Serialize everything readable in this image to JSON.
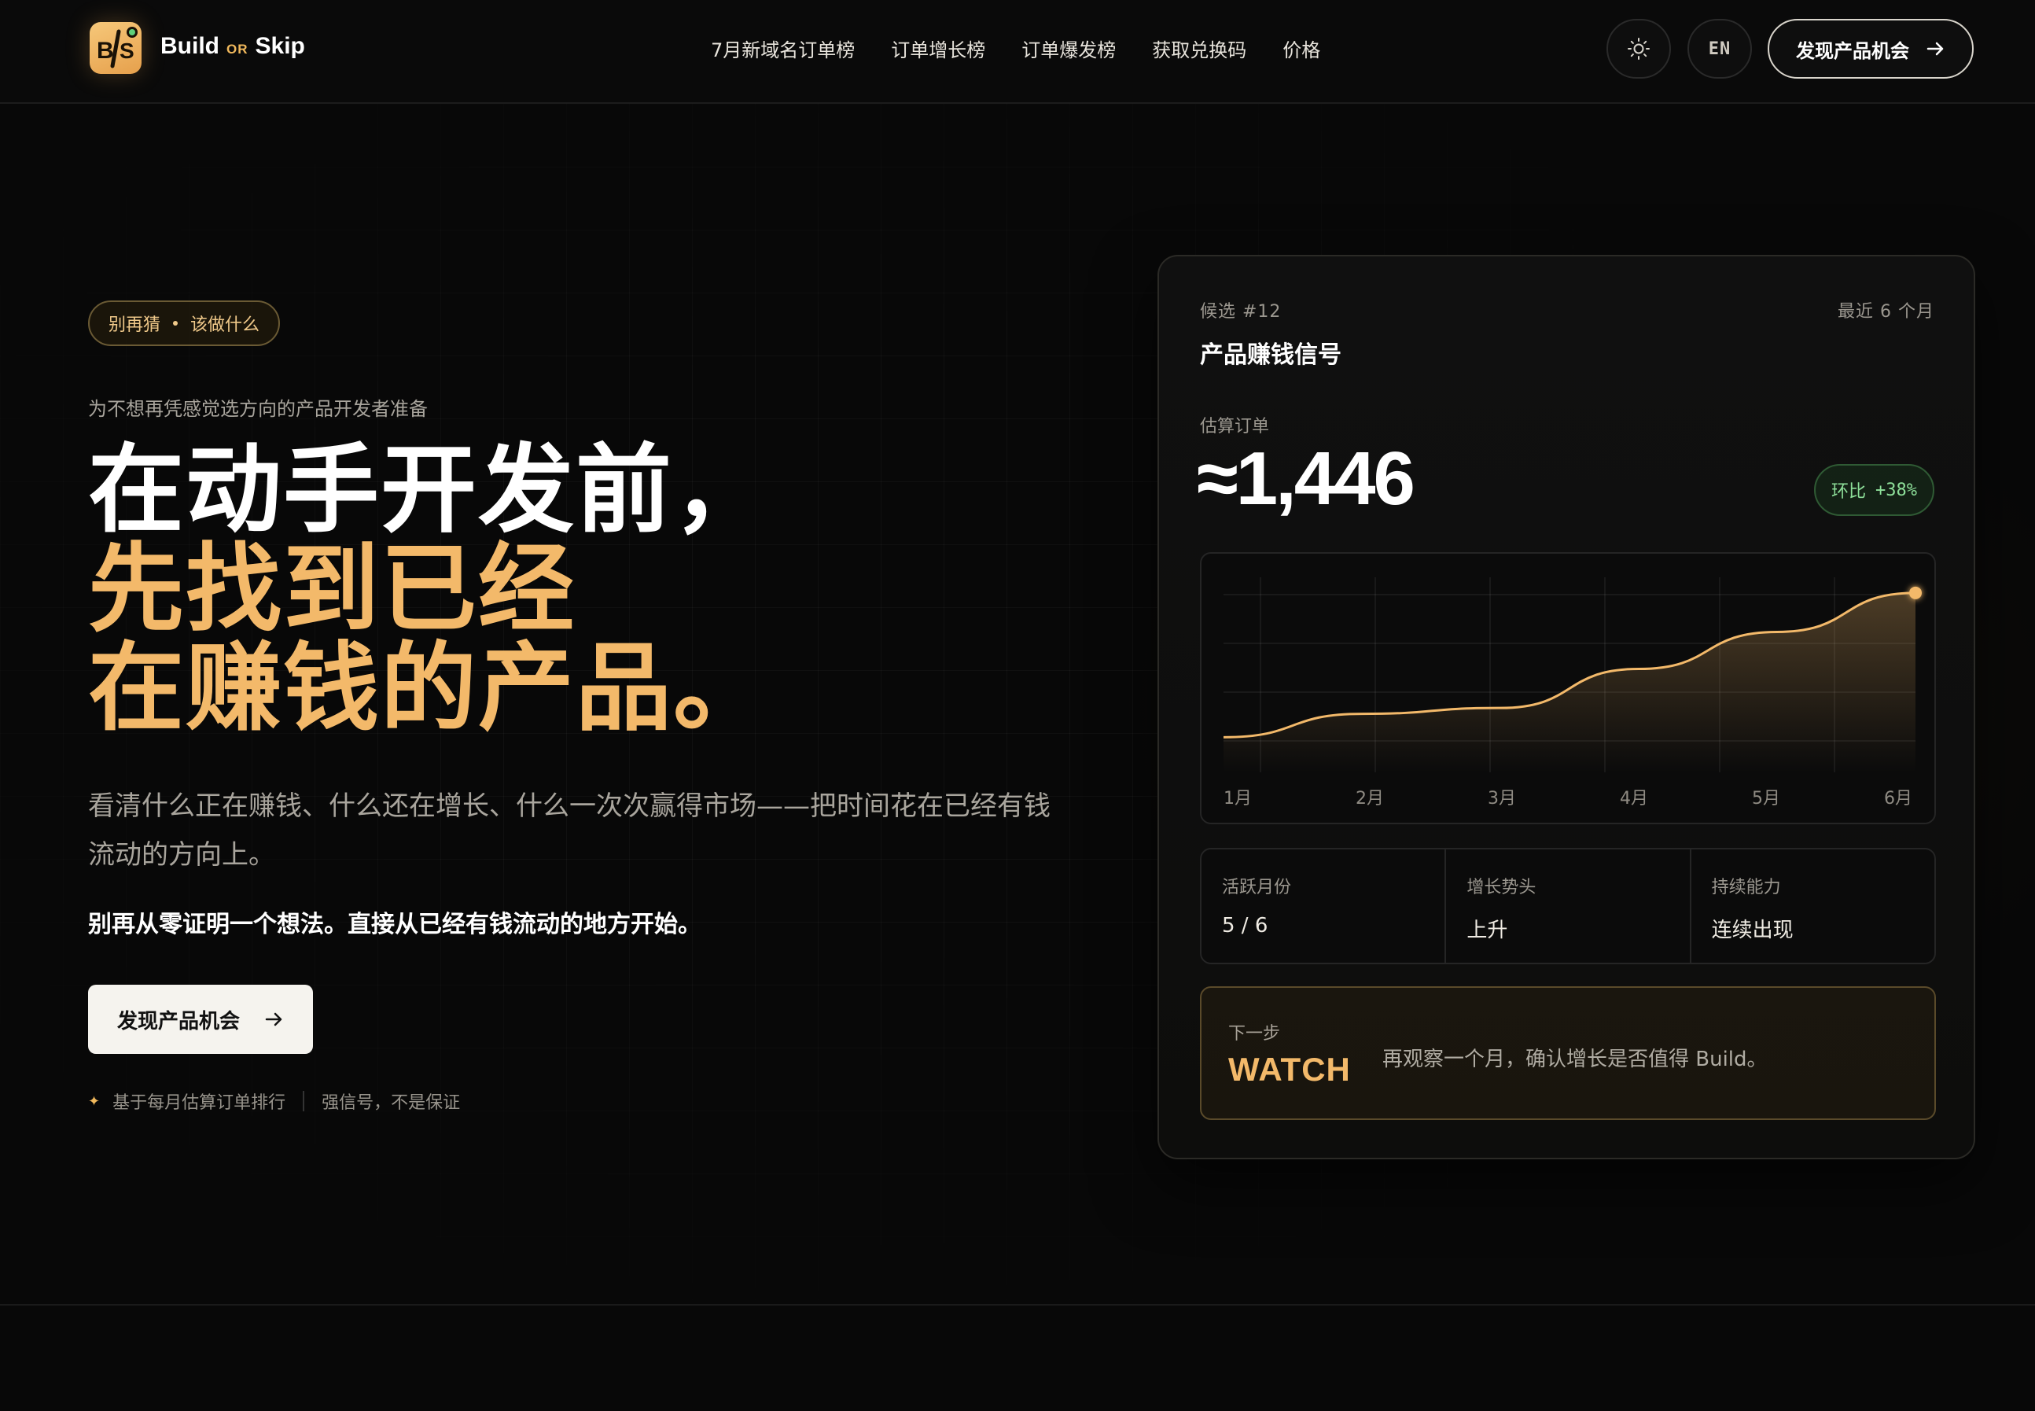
{
  "brand": {
    "name_left": "Build",
    "name_or": "OR",
    "name_right": "Skip",
    "logo_text": "B/S",
    "accent": "#F3B96A"
  },
  "nav": {
    "items": [
      "7月新域名订单榜",
      "订单增长榜",
      "订单爆发榜",
      "获取兑换码",
      "价格"
    ]
  },
  "header": {
    "theme_icon": "sun-icon",
    "lang_label": "EN",
    "cta_label": "发现产品机会",
    "cta_icon": "arrow-right-icon"
  },
  "hero": {
    "pill_left": "别再猜",
    "pill_right": "该做什么",
    "subtitle": "为不想再凭感觉选方向的产品开发者准备",
    "headline_1": "在动手开发前，",
    "headline_2": "先找到已经",
    "headline_3": "在赚钱的产品。",
    "description": "看清什么正在赚钱、什么还在增长、什么一次次赢得市场——把时间花在已经有钱流动的方向上。",
    "bold_line": "别再从零证明一个想法。直接从已经有钱流动的地方开始。",
    "cta_label": "发现产品机会",
    "note_1": "基于每月估算订单排行",
    "note_2": "强信号，不是保证"
  },
  "card": {
    "tag": "候选 #12",
    "period": "最近 6 个月",
    "title": "产品赚钱信号",
    "est_label": "估算订单",
    "est_value": "≈1,446",
    "badge_label": "环比",
    "badge_value": "+38%",
    "badge_color": "#8EE09A",
    "stats": [
      {
        "label": "活跃月份",
        "value": "5 / 6"
      },
      {
        "label": "增长势头",
        "value": "上升"
      },
      {
        "label": "持续能力",
        "value": "连续出现"
      }
    ],
    "next_label": "下一步",
    "next_verdict": "WATCH",
    "next_message": "再观察一个月，确认增长是否值得 Build。"
  },
  "chart_data": {
    "type": "area",
    "categories": [
      "1月",
      "2月",
      "3月",
      "4月",
      "5月",
      "6月"
    ],
    "values": [
      0.18,
      0.3,
      0.33,
      0.53,
      0.72,
      0.92
    ],
    "y_range": [
      0,
      1
    ],
    "grid": true,
    "line_color": "#F3B96A"
  }
}
